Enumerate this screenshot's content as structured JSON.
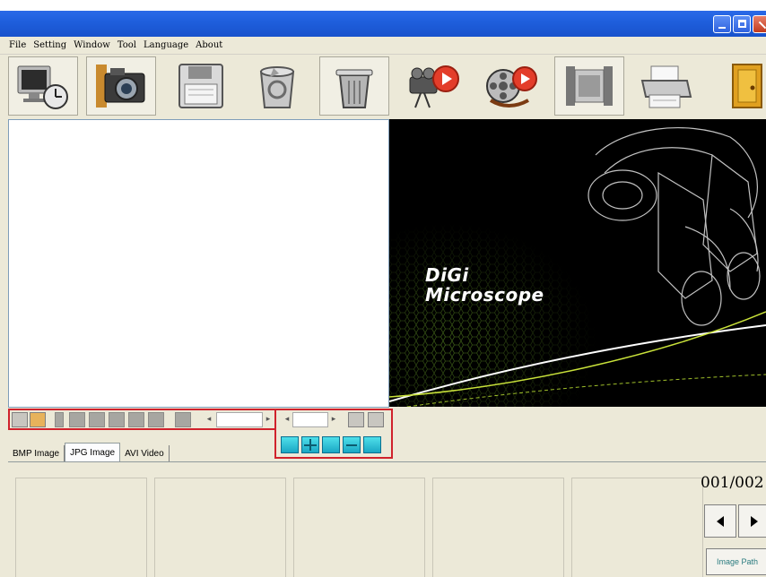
{
  "menu": [
    "File",
    "Setting",
    "Window",
    "Tool",
    "Language",
    "About"
  ],
  "toolbar_icons": [
    "monitor-clock-icon",
    "camera-icon",
    "floppy-save-icon",
    "recycle-bin-icon",
    "trash-can-icon",
    "video-camera-record-icon",
    "film-reel-record-icon",
    "filmstrip-icon",
    "printer-icon",
    "exit-door-icon"
  ],
  "splash": {
    "line1": "DiGi",
    "line2": "Microscope"
  },
  "tabs": [
    {
      "label": "BMP Image",
      "active": false
    },
    {
      "label": "JPG Image",
      "active": true
    },
    {
      "label": "AVI Video",
      "active": false
    }
  ],
  "gallery": {
    "counter": "001/002",
    "image_path_label": "Image Path"
  },
  "colors": {
    "title_blue": "#1f5fdd",
    "highlight_red": "#d0222c",
    "accent_cyan": "#1aa7c4"
  }
}
